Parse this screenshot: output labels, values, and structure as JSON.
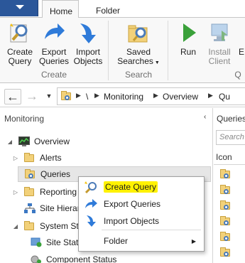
{
  "ribbon": {
    "tabs": [
      "Home",
      "Folder"
    ],
    "buttons": {
      "create_query": "Create Query",
      "export_queries": "Export Queries",
      "import_objects": "Import Objects",
      "saved_searches": "Saved Searches",
      "run": "Run",
      "install_client": "Install Client",
      "partial": "E"
    },
    "groups": {
      "create": "Create",
      "search": "Search",
      "partial": "Q"
    }
  },
  "address": {
    "root": "\\",
    "crumbs": [
      "Monitoring",
      "Overview",
      "Qu"
    ]
  },
  "nav": {
    "title": "Monitoring",
    "collapse_glyph": "‹",
    "items": [
      {
        "label": "Overview",
        "icon": "overview-icon"
      },
      {
        "label": "Alerts",
        "icon": "folder-icon"
      },
      {
        "label": "Queries",
        "icon": "query-folder-icon"
      },
      {
        "label": "Reporting",
        "icon": "folder-icon"
      },
      {
        "label": "Site Hierarc",
        "icon": "site-hierarchy-icon"
      },
      {
        "label": "System Stat",
        "icon": "folder-icon"
      },
      {
        "label": "Site Status",
        "icon": "site-status-icon"
      },
      {
        "label": "Component Status",
        "icon": "component-status-icon"
      }
    ]
  },
  "right_pane": {
    "title": "Queries",
    "search_placeholder": "Search",
    "column": "Icon"
  },
  "context_menu": {
    "items": [
      {
        "label": "Create Query",
        "icon": "create-query-icon",
        "highlighted": true
      },
      {
        "label": "Export Queries",
        "icon": "export-icon"
      },
      {
        "label": "Import Objects",
        "icon": "import-icon"
      },
      {
        "label": "Folder",
        "icon": "",
        "submenu": true
      }
    ],
    "submenu_glyph": "▶"
  },
  "colors": {
    "app_button": "#2b579a",
    "highlight": "#fff200",
    "folder": "#f2d17a",
    "arrow_blue": "#2f7bd9",
    "run_green": "#3aa13a"
  }
}
